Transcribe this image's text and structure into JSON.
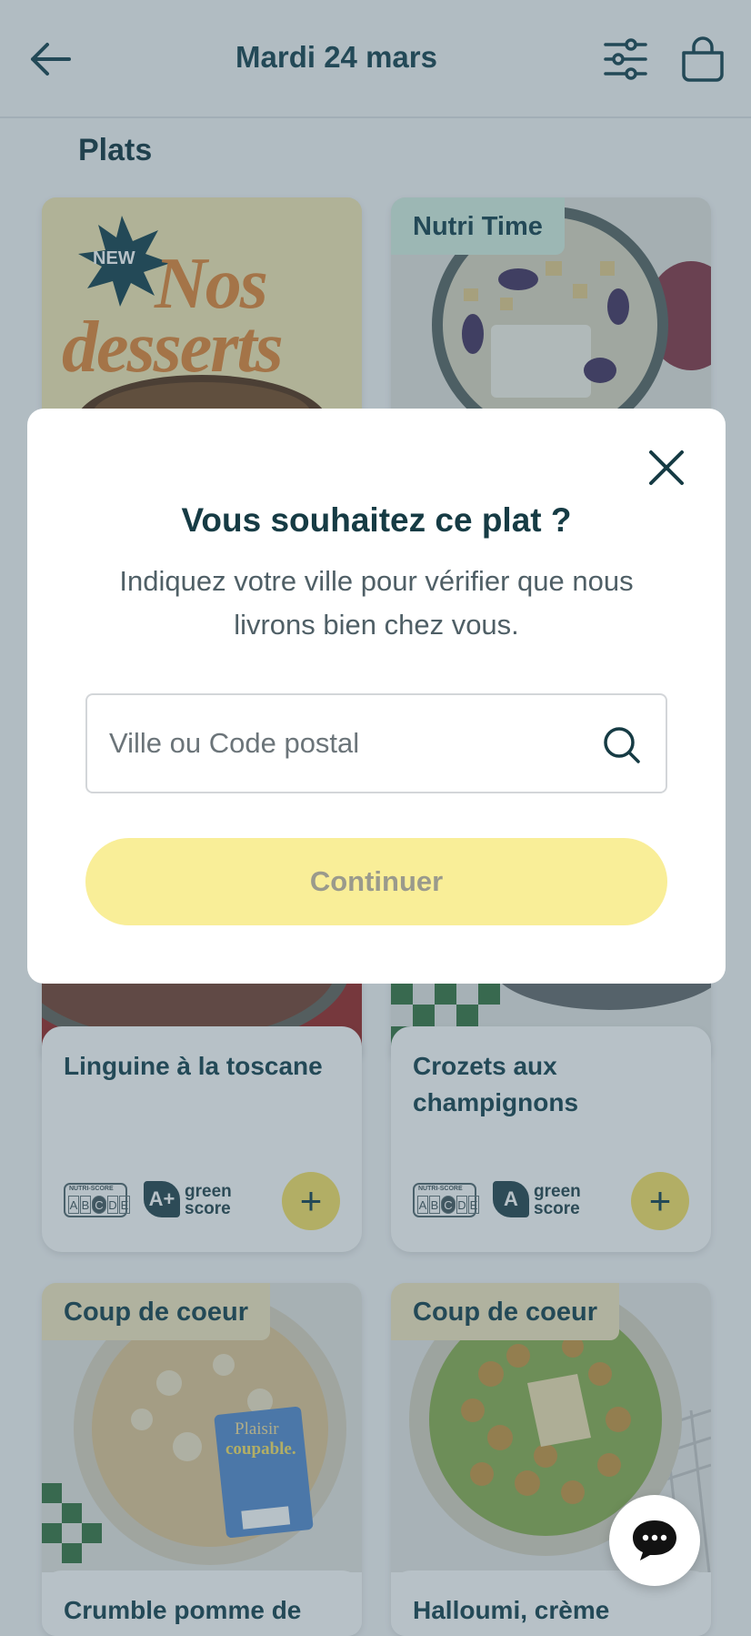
{
  "header": {
    "back_icon": "arrow-left-icon",
    "title": "Mardi 24 mars",
    "filters_icon": "filters-icon",
    "basket_icon": "basket-icon"
  },
  "section_title": "Plats",
  "promo_card": {
    "new_label": "NEW",
    "title_line1": "Nos",
    "title_line2": "desserts"
  },
  "cards": [
    {
      "badge": "Nutri Time"
    },
    {
      "name": "Linguine à la toscane",
      "nutri_label": "NUTRI-SCORE",
      "nutri_letters": [
        "A",
        "B",
        "C",
        "D",
        "E"
      ],
      "nutri_grade": "C",
      "green_grade": "A+",
      "green_label_1": "green",
      "green_label_2": "score",
      "add": "+"
    },
    {
      "name": "Crozets aux champignons",
      "nutri_label": "NUTRI-SCORE",
      "nutri_letters": [
        "A",
        "B",
        "C",
        "D",
        "E"
      ],
      "nutri_grade": "C",
      "green_grade": "A",
      "green_label_1": "green",
      "green_label_2": "score",
      "add": "+"
    },
    {
      "badge": "Coup de coeur",
      "name": "Crumble pomme de",
      "sticker_1": "Plaisir",
      "sticker_2": "coupable."
    },
    {
      "badge": "Coup de coeur",
      "name": "Halloumi, crème"
    }
  ],
  "modal": {
    "close_icon": "close-icon",
    "title": "Vous souhaitez ce plat ?",
    "description": "Indiquez votre ville pour vérifier que nous livrons bien chez vous.",
    "search_placeholder": "Ville ou Code postal",
    "search_icon": "search-icon",
    "continue_label": "Continuer"
  },
  "chat": {
    "icon": "chat-icon"
  },
  "colors": {
    "accent_yellow": "#f7e36b",
    "button_disabled": "#f9ee98",
    "text_dark": "#163b44"
  }
}
